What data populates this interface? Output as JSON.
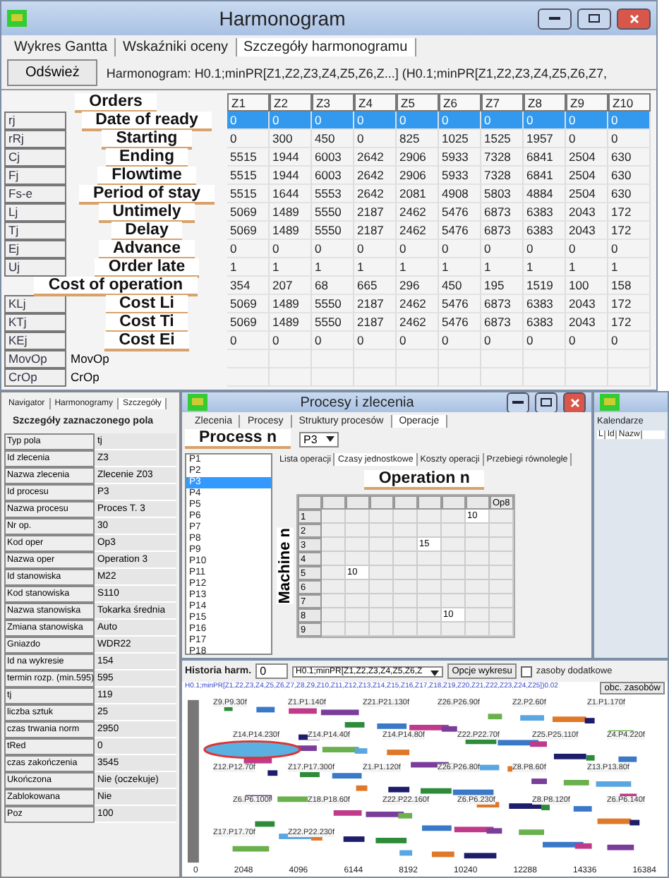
{
  "top_window": {
    "title": "Harmonogram",
    "tabs": [
      {
        "label": "Wykres Gantta",
        "selected": false
      },
      {
        "label": "Wskaźniki oceny",
        "selected": false
      },
      {
        "label": "Szczegóły harmonogramu",
        "selected": true
      }
    ],
    "refresh_button": "Odśwież",
    "schedule_label": "Harmonogram: H0.1;minPR[Z1,Z2,Z3,Z4,Z5,Z6,Z...] (H0.1;minPR[Z1,Z2,Z3,Z4,Z5,Z6,Z7,",
    "table": {
      "header_annotation": "Orders",
      "columns": [
        "Z1",
        "Z2",
        "Z3",
        "Z4",
        "Z5",
        "Z6",
        "Z7",
        "Z8",
        "Z9",
        "Z10"
      ],
      "rows": [
        {
          "code": "rj",
          "annotation": "Date of ready",
          "selected": true,
          "values": [
            "0",
            "0",
            "0",
            "0",
            "0",
            "0",
            "0",
            "0",
            "0",
            "0"
          ]
        },
        {
          "code": "rRj",
          "annotation": "Starting",
          "selected": false,
          "values": [
            "0",
            "300",
            "450",
            "0",
            "825",
            "1025",
            "1525",
            "1957",
            "0",
            "0"
          ]
        },
        {
          "code": "Cj",
          "annotation": "Ending",
          "selected": false,
          "values": [
            "5515",
            "1944",
            "6003",
            "2642",
            "2906",
            "5933",
            "7328",
            "6841",
            "2504",
            "630"
          ]
        },
        {
          "code": "Fj",
          "annotation": "Flowtime",
          "selected": false,
          "values": [
            "5515",
            "1944",
            "6003",
            "2642",
            "2906",
            "5933",
            "7328",
            "6841",
            "2504",
            "630"
          ]
        },
        {
          "code": "Fs-e",
          "annotation": "Period of stay",
          "selected": false,
          "values": [
            "5515",
            "1644",
            "5553",
            "2642",
            "2081",
            "4908",
            "5803",
            "4884",
            "2504",
            "630"
          ]
        },
        {
          "code": "Lj",
          "annotation": "Untimely",
          "selected": false,
          "values": [
            "5069",
            "1489",
            "5550",
            "2187",
            "2462",
            "5476",
            "6873",
            "6383",
            "2043",
            "172"
          ]
        },
        {
          "code": "Tj",
          "annotation": "Delay",
          "selected": false,
          "values": [
            "5069",
            "1489",
            "5550",
            "2187",
            "2462",
            "5476",
            "6873",
            "6383",
            "2043",
            "172"
          ]
        },
        {
          "code": "Ej",
          "annotation": "Advance",
          "selected": false,
          "values": [
            "0",
            "0",
            "0",
            "0",
            "0",
            "0",
            "0",
            "0",
            "0",
            "0"
          ]
        },
        {
          "code": "Uj",
          "annotation": "Order late",
          "selected": false,
          "values": [
            "1",
            "1",
            "1",
            "1",
            "1",
            "1",
            "1",
            "1",
            "1",
            "1"
          ]
        },
        {
          "annotation": "Cost of  operation",
          "selected": false,
          "values": [
            "354",
            "207",
            "68",
            "665",
            "296",
            "450",
            "195",
            "1519",
            "100",
            "158"
          ]
        },
        {
          "code": "KLj",
          "annotation": "Cost Li",
          "selected": false,
          "values": [
            "5069",
            "1489",
            "5550",
            "2187",
            "2462",
            "5476",
            "6873",
            "6383",
            "2043",
            "172"
          ]
        },
        {
          "code": "KTj",
          "annotation": "Cost Ti",
          "selected": false,
          "values": [
            "5069",
            "1489",
            "5550",
            "2187",
            "2462",
            "5476",
            "6873",
            "6383",
            "2043",
            "172"
          ]
        },
        {
          "code": "KEj",
          "annotation": "Cost Ei",
          "selected": false,
          "values": [
            "0",
            "0",
            "0",
            "0",
            "0",
            "0",
            "0",
            "0",
            "0",
            "0"
          ]
        },
        {
          "code": "MovOp",
          "name": "MovOp",
          "selected": false
        },
        {
          "code": "CrOp",
          "name": "CrOp",
          "selected": false
        }
      ]
    }
  },
  "details_panel": {
    "tabs": [
      {
        "label": "Navigator",
        "selected": false
      },
      {
        "label": "Harmonogramy",
        "selected": false
      },
      {
        "label": "Szczegóły",
        "selected": true
      }
    ],
    "title": "Szczegóły zaznaczonego pola",
    "properties": [
      {
        "name": "Typ pola",
        "value": "tj"
      },
      {
        "name": "Id zlecenia",
        "value": "Z3"
      },
      {
        "name": "Nazwa zlecenia",
        "value": "Zlecenie Z03"
      },
      {
        "name": "Id procesu",
        "value": "P3"
      },
      {
        "name": "Nazwa procesu",
        "value": "Proces T. 3"
      },
      {
        "name": "Nr op.",
        "value": "30"
      },
      {
        "name": "Kod oper",
        "value": "Op3"
      },
      {
        "name": "Nazwa oper",
        "value": "Operation 3"
      },
      {
        "name": "Id stanowiska",
        "value": "M22"
      },
      {
        "name": "Kod stanowiska",
        "value": "S110"
      },
      {
        "name": "Nazwa stanowiska",
        "value": "Tokarka średnia"
      },
      {
        "name": "Zmiana stanowiska",
        "value": "Auto"
      },
      {
        "name": "Gniazdo",
        "value": "WDR22"
      },
      {
        "name": "Id na wykresie",
        "value": "154"
      },
      {
        "name": "termin rozp. (min.595)",
        "value": "595"
      },
      {
        "name": "tj",
        "value": "119"
      },
      {
        "name": "liczba sztuk",
        "value": "25"
      },
      {
        "name": "czas trwania norm",
        "value": "2950"
      },
      {
        "name": "tRed",
        "value": "0"
      },
      {
        "name": "czas zakończenia",
        "value": "3545"
      },
      {
        "name": "Ukończona",
        "value": "Nie (oczekuje)"
      },
      {
        "name": "Zablokowana",
        "value": "Nie"
      },
      {
        "name": "Poz",
        "value": "100"
      }
    ]
  },
  "process_window": {
    "title": "Procesy i zlecenia",
    "tabs": [
      {
        "label": "Zlecenia",
        "selected": false
      },
      {
        "label": "Procesy",
        "selected": false
      },
      {
        "label": "Struktury procesów",
        "selected": false
      },
      {
        "label": "Operacje",
        "selected": true
      }
    ],
    "process_annotation": "Process n",
    "process_select": "P3",
    "processes": [
      {
        "label": "P1",
        "selected": false
      },
      {
        "label": "P2",
        "selected": false
      },
      {
        "label": "P3",
        "selected": true
      },
      {
        "label": "P4",
        "selected": false
      },
      {
        "label": "P5",
        "selected": false
      },
      {
        "label": "P6",
        "selected": false
      },
      {
        "label": "P7",
        "selected": false
      },
      {
        "label": "P8",
        "selected": false
      },
      {
        "label": "P9",
        "selected": false
      },
      {
        "label": "P10",
        "selected": false
      },
      {
        "label": "P11",
        "selected": false
      },
      {
        "label": "P12",
        "selected": false
      },
      {
        "label": "P13",
        "selected": false
      },
      {
        "label": "P14",
        "selected": false
      },
      {
        "label": "P15",
        "selected": false
      },
      {
        "label": "P16",
        "selected": false
      },
      {
        "label": "P17",
        "selected": false
      },
      {
        "label": "P18",
        "selected": false
      }
    ],
    "subtabs": [
      {
        "label": "Lista operacji",
        "selected": false
      },
      {
        "label": "Czasy jednostkowe",
        "selected": true
      },
      {
        "label": "Koszty operacji",
        "selected": false
      },
      {
        "label": "Przebiegi równoległe",
        "selected": false
      }
    ],
    "grid": {
      "operation_annotation": "Operation n",
      "machine_annotation": "Machine n",
      "last_column": "Op8",
      "rows": [
        {
          "label": "1",
          "cells": [
            null,
            null,
            null,
            null,
            null,
            null,
            "10",
            null
          ]
        },
        {
          "label": "2",
          "cells": [
            null,
            null,
            null,
            null,
            null,
            null,
            null,
            null
          ]
        },
        {
          "label": "3",
          "cells": [
            null,
            null,
            null,
            null,
            "15",
            null,
            null,
            null
          ]
        },
        {
          "label": "4",
          "cells": [
            null,
            null,
            null,
            null,
            null,
            null,
            null,
            null
          ]
        },
        {
          "label": "5",
          "cells": [
            null,
            "10",
            null,
            null,
            null,
            null,
            null,
            null
          ]
        },
        {
          "label": "6",
          "cells": [
            null,
            null,
            null,
            null,
            null,
            null,
            null,
            null
          ]
        },
        {
          "label": "7",
          "cells": [
            null,
            null,
            null,
            null,
            null,
            null,
            null,
            null
          ]
        },
        {
          "label": "8",
          "cells": [
            null,
            null,
            null,
            null,
            null,
            "10",
            null,
            null
          ]
        },
        {
          "label": "9",
          "cells": [
            null,
            null,
            null,
            null,
            null,
            null,
            null,
            null
          ]
        }
      ]
    }
  },
  "calendar_window": {
    "title": "Kalendarze",
    "columns": [
      "L",
      "Id",
      "Nazw"
    ]
  },
  "gantt_window": {
    "history_label": "Historia harm.",
    "history_value": "0",
    "schedule_select": "H0.1;minPR[Z1,Z2,Z3,Z4,Z5,Z6,Z",
    "options_button": "Opcje wykresu",
    "extra_resources": {
      "label": "zasoby dodatkowe",
      "checked": false
    },
    "load_button": "obc. zasobów",
    "chart_title": "H0.1;minPR[Z1,Z2,Z3,Z4,Z5,Z6,Z7,Z8,Z9,Z10,Z11,Z12,Z13,Z14,Z15,Z16,Z17,Z18,Z19,Z20,Z21,Z22,Z23,Z24,Z25])0.02",
    "bar_labels": [
      "Z9.P9.30f",
      "Z1.P1.140f",
      "Z21.P21.130f",
      "Z26.P26.90f",
      "Z2.P2.60f",
      "Z1.P1.170f",
      "Z14.P14.230f",
      "Z14.P14.40f",
      "Z14.P14.80f",
      "Z22.P22.70f",
      "Z25.P25.110f",
      "Z4.P4.220f",
      "Z12.P12.70f",
      "Z17.P17.300f",
      "Z1.P1.120f",
      "Z26.P26.80f",
      "Z8.P8.60f",
      "Z13.P13.80f",
      "Z6.P6.100f",
      "Z18.P18.60f",
      "Z22.P22.160f",
      "Z6.P6.230f",
      "Z8.P8.120f",
      "Z6.P6.140f",
      "Z17.P17.70f",
      "Z22.P22.230f"
    ],
    "x_ticks": [
      "0",
      "2048",
      "4096",
      "6144",
      "8192",
      "10240",
      "12288",
      "14336",
      "16384"
    ]
  }
}
